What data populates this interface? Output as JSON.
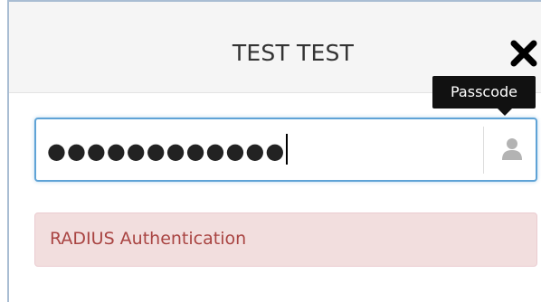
{
  "dialog": {
    "title": "TEST TEST",
    "close_icon": "close-icon"
  },
  "tooltip": {
    "text": "Passcode"
  },
  "passcode_field": {
    "masked_value": "●●●●●●●●●●●●",
    "icon": "user-icon",
    "focus_color": "#5fa3d6"
  },
  "alert": {
    "text": "RADIUS Authentication",
    "background": "#f2dede",
    "text_color": "#a94442"
  }
}
